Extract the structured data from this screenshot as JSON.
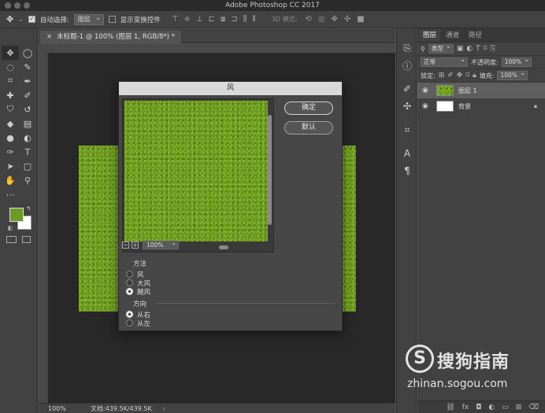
{
  "app": {
    "title": "Adobe Photoshop CC 2017"
  },
  "options": {
    "auto_select_label": "自动选择:",
    "auto_select_value": "图层",
    "show_transform_label": "显示变换控件",
    "mode_3d_label": "3D 模式:"
  },
  "document": {
    "tab_title": "未标题-1 @ 100% (图层 1, RGB/8*) *",
    "close_glyph": "×",
    "status_zoom": "100%",
    "status_doc": "文档:439.5K/439.5K"
  },
  "dialog": {
    "title": "风",
    "ok_label": "确定",
    "default_label": "默认",
    "zoom_value": "100%",
    "zoom_out": "−",
    "zoom_in": "+",
    "method_title": "方法",
    "method_options": [
      "风",
      "大风",
      "飓风"
    ],
    "method_selected": 2,
    "direction_title": "方向",
    "direction_options": [
      "从右",
      "从左"
    ],
    "direction_selected": 0
  },
  "layers_panel": {
    "tabs": [
      "图层",
      "通道",
      "路径"
    ],
    "active_tab": 0,
    "filter_label": "类型",
    "blend_mode": "正常",
    "opacity_label": "不透明度:",
    "opacity_value": "100%",
    "lock_label": "锁定:",
    "fill_label": "填充:",
    "fill_value": "100%",
    "layers": [
      {
        "name": "图层 1",
        "selected": true
      },
      {
        "name": "背景",
        "selected": false,
        "locked": true
      }
    ]
  },
  "colors": {
    "foreground": "#6a9b22",
    "background": "#ffffff",
    "grass": "#6c9a24"
  },
  "watermark": {
    "logo_letter": "S",
    "title": "搜狗指南",
    "url": "zhinan.sogou.com"
  }
}
